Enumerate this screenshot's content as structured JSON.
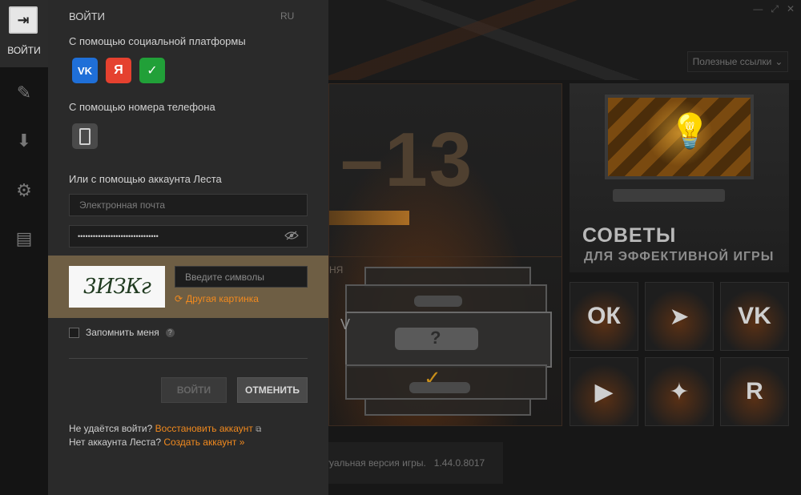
{
  "rail": {
    "login_label": "ВОЙТИ",
    "icons": [
      "login-icon",
      "notifications-icon",
      "download-icon",
      "settings-icon",
      "chat-icon"
    ]
  },
  "panel": {
    "title": "ВОЙТИ",
    "language": "RU",
    "social_label": "С помощью социальной платформы",
    "social_buttons": [
      {
        "name": "vk",
        "glyph": "VK",
        "color": "#1f6fd8"
      },
      {
        "name": "yandex",
        "glyph": "Я",
        "color": "#e5412f"
      },
      {
        "name": "sber",
        "glyph": "✓",
        "color": "#21a038"
      }
    ],
    "phone_label": "С помощью номера телефона",
    "lesta_label": "Или с помощью аккаунта Леста",
    "email_placeholder": "Электронная почта",
    "password_value": "••••••••••••••••••••••••••••••••",
    "captcha_text": "3ИЗКг",
    "captcha_placeholder": "Введите символы",
    "captcha_refresh": "Другая картинка",
    "remember_label": "Запомнить меня",
    "login_button": "ВОЙТИ",
    "cancel_button": "ОТМЕНИТЬ",
    "cant_login": "Не удаётся войти?",
    "restore_link": "Восстановить аккаунт",
    "no_account": "Нет аккаунта Леста?",
    "create_link": "Создать аккаунт »"
  },
  "background": {
    "useful_links": "Полезные ссылки",
    "banner_number": "–13",
    "banner_label": "НЯ",
    "banner_roman": "V",
    "tips_title": "СОВЕТЫ",
    "tips_subtitle": "ДЛЯ ЭФФЕКТИВНОЙ ИГРЫ",
    "version_text": "ктуальная версия игры.",
    "version_number": "1.44.0.8017",
    "social_tiles": [
      "odnoklassniki-icon",
      "telegram-icon",
      "vk-icon",
      "youtube-icon",
      "zen-icon",
      "rutube-icon"
    ]
  },
  "colors": {
    "accent": "#f28a1e",
    "panel_bg": "#2a2a2a",
    "captcha_strip": "#6e5e44"
  }
}
